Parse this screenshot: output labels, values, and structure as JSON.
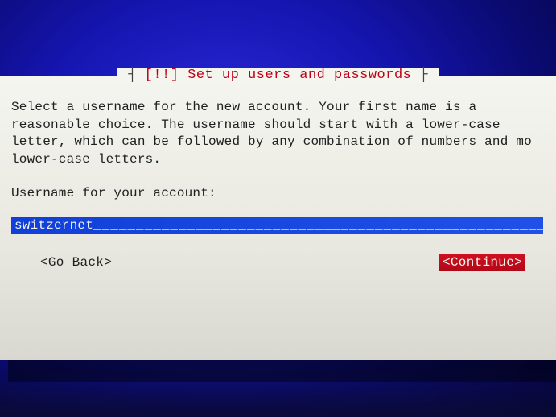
{
  "dialog": {
    "title": "[!!] Set up users and passwords",
    "body": "Select a username for the new account. Your first name is a\nreasonable choice. The username should start with a lower-case\nletter, which can be followed by any combination of numbers and mo\nlower-case letters.",
    "prompt": "Username for your account:",
    "input_value": "switzernet",
    "input_padding": "___________________________________________________________________________",
    "back_label": "<Go Back>",
    "continue_label": "<Continue>"
  }
}
